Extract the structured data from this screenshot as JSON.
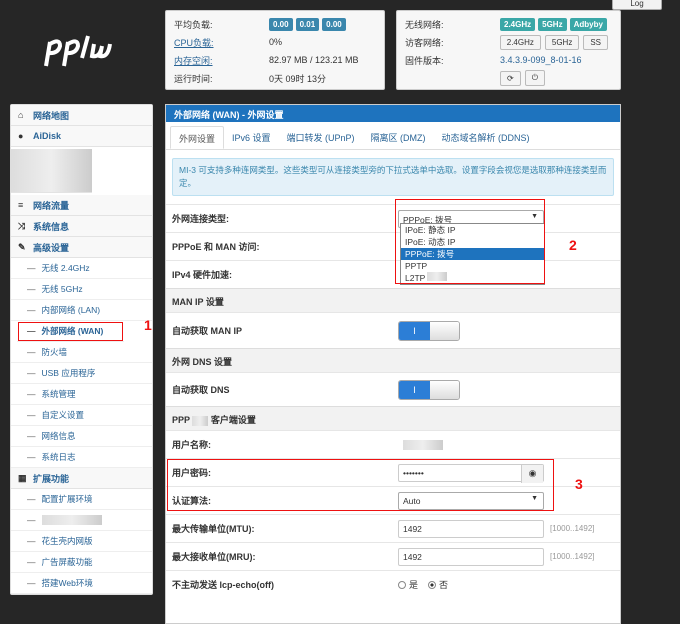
{
  "header": {
    "logout_label": "Log"
  },
  "status_left": {
    "rows": [
      {
        "label": "平均负载:",
        "badges": [
          "0.00",
          "0.01",
          "0.00"
        ]
      },
      {
        "label": "CPU负载:",
        "value": "0%"
      },
      {
        "label": "内存空闲:",
        "value": "82.97 MB / 123.21 MB"
      },
      {
        "label": "运行时间:",
        "value": "0天 09时 13分"
      }
    ]
  },
  "status_right": {
    "wireless_label": "无线网络:",
    "wireless_badges": [
      "2.4GHz",
      "5GHz",
      "Adbyby"
    ],
    "guest_label": "访客网络:",
    "guest_buttons": [
      "2.4GHz",
      "5GHz",
      "SS"
    ],
    "firmware_label": "固件版本:",
    "firmware_value": "3.4.3.9-099_8-01-16"
  },
  "sidebar": {
    "items": [
      {
        "label": "网络地图",
        "icon": "home-icon",
        "type": "main"
      },
      {
        "label": "AiDisk",
        "icon": "user-icon",
        "type": "main"
      },
      {
        "label": "网络流量",
        "icon": "list-icon",
        "type": "main"
      },
      {
        "label": "系统信息",
        "icon": "shuffle-icon",
        "type": "main"
      },
      {
        "label": "高级设置",
        "icon": "wrench-icon",
        "type": "main"
      },
      {
        "label": "无线 2.4GHz",
        "type": "sub"
      },
      {
        "label": "无线 5GHz",
        "type": "sub"
      },
      {
        "label": "内部网络 (LAN)",
        "type": "sub"
      },
      {
        "label": "外部网络 (WAN)",
        "type": "sub",
        "active": true
      },
      {
        "label": "防火墙",
        "type": "sub"
      },
      {
        "label": "USB 应用程序",
        "type": "sub"
      },
      {
        "label": "系统管理",
        "type": "sub"
      },
      {
        "label": "自定义设置",
        "type": "sub"
      },
      {
        "label": "网络信息",
        "type": "sub"
      },
      {
        "label": "系统日志",
        "type": "sub"
      },
      {
        "label": "扩展功能",
        "icon": "grid-icon",
        "type": "main"
      },
      {
        "label": "配置扩展环境",
        "type": "sub"
      },
      {
        "label": "",
        "type": "sub",
        "blurred": true
      },
      {
        "label": "花生壳内网版",
        "type": "sub"
      },
      {
        "label": "广告屏蔽功能",
        "type": "sub"
      },
      {
        "label": "搭建Web环境",
        "type": "sub"
      }
    ]
  },
  "main": {
    "title": "外部网络 (WAN) - 外网设置",
    "tabs": [
      "外网设置",
      "IPv6 设置",
      "端口转发 (UPnP)",
      "隔离区 (DMZ)",
      "动态域名解析 (DDNS)"
    ],
    "alert": "MI-3 可支持多种连网类型。这些类型可从连接类型旁的下拉式选单中选取。设置字段会视您是选取那种连接类型而定。",
    "wan_type_label": "外网连接类型:",
    "wan_type_value": "PPPoE: 拨号",
    "wan_type_options": [
      "IPoE: 静态 IP",
      "IPoE: 动态 IP",
      "PPPoE: 拨号",
      "PPTP",
      "L2TP"
    ],
    "pppoe_man_label": "PPPoE 和 MAN 访问:",
    "ipv4_hw_label": "IPv4 硬件加速:",
    "man_section": "MAN IP 设置",
    "man_auto_label": "自动获取 MAN IP",
    "toggle_on": "I",
    "dns_section": "外网 DNS 设置",
    "dns_auto_label": "自动获取 DNS",
    "ppp_section_prefix": "PPP",
    "ppp_section_suffix": "客户端设置",
    "username_label": "用户名称:",
    "password_label": "用户密码:",
    "password_value": "•••••••",
    "auth_label": "认证算法:",
    "auth_value": "Auto",
    "mtu_label": "最大传输单位(MTU):",
    "mtu_value": "1492",
    "mtu_hint": "[1000..1492]",
    "mru_label": "最大接收单位(MRU):",
    "mru_value": "1492",
    "mru_hint": "[1000..1492]",
    "lcp_label": "不主动发送 lcp-echo(off)",
    "lcp_yes": "是",
    "lcp_no": "否"
  },
  "annotations": [
    "1",
    "2",
    "3"
  ]
}
